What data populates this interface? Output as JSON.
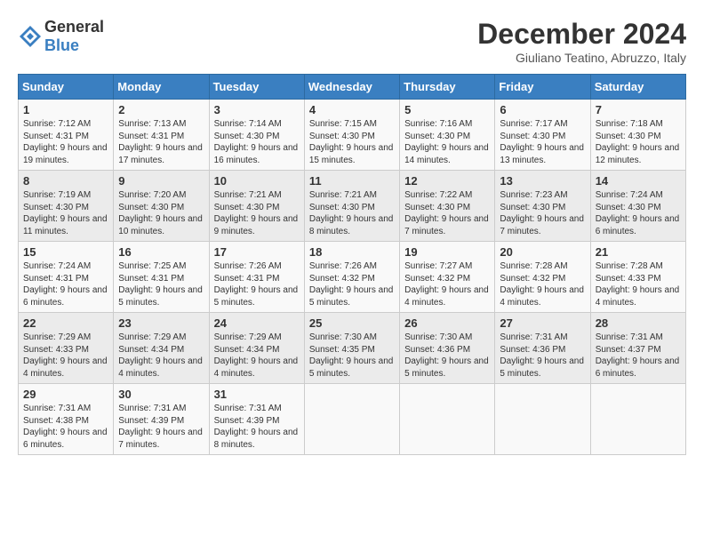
{
  "header": {
    "logo_general": "General",
    "logo_blue": "Blue",
    "month_title": "December 2024",
    "location": "Giuliano Teatino, Abruzzo, Italy"
  },
  "days_of_week": [
    "Sunday",
    "Monday",
    "Tuesday",
    "Wednesday",
    "Thursday",
    "Friday",
    "Saturday"
  ],
  "weeks": [
    [
      {
        "day": "1",
        "sunrise": "7:12 AM",
        "sunset": "4:31 PM",
        "daylight_hours": "9",
        "daylight_minutes": "19"
      },
      {
        "day": "2",
        "sunrise": "7:13 AM",
        "sunset": "4:31 PM",
        "daylight_hours": "9",
        "daylight_minutes": "17"
      },
      {
        "day": "3",
        "sunrise": "7:14 AM",
        "sunset": "4:30 PM",
        "daylight_hours": "9",
        "daylight_minutes": "16"
      },
      {
        "day": "4",
        "sunrise": "7:15 AM",
        "sunset": "4:30 PM",
        "daylight_hours": "9",
        "daylight_minutes": "15"
      },
      {
        "day": "5",
        "sunrise": "7:16 AM",
        "sunset": "4:30 PM",
        "daylight_hours": "9",
        "daylight_minutes": "14"
      },
      {
        "day": "6",
        "sunrise": "7:17 AM",
        "sunset": "4:30 PM",
        "daylight_hours": "9",
        "daylight_minutes": "13"
      },
      {
        "day": "7",
        "sunrise": "7:18 AM",
        "sunset": "4:30 PM",
        "daylight_hours": "9",
        "daylight_minutes": "12"
      }
    ],
    [
      {
        "day": "8",
        "sunrise": "7:19 AM",
        "sunset": "4:30 PM",
        "daylight_hours": "9",
        "daylight_minutes": "11"
      },
      {
        "day": "9",
        "sunrise": "7:20 AM",
        "sunset": "4:30 PM",
        "daylight_hours": "9",
        "daylight_minutes": "10"
      },
      {
        "day": "10",
        "sunrise": "7:21 AM",
        "sunset": "4:30 PM",
        "daylight_hours": "9",
        "daylight_minutes": "9"
      },
      {
        "day": "11",
        "sunrise": "7:21 AM",
        "sunset": "4:30 PM",
        "daylight_hours": "9",
        "daylight_minutes": "8"
      },
      {
        "day": "12",
        "sunrise": "7:22 AM",
        "sunset": "4:30 PM",
        "daylight_hours": "9",
        "daylight_minutes": "7"
      },
      {
        "day": "13",
        "sunrise": "7:23 AM",
        "sunset": "4:30 PM",
        "daylight_hours": "9",
        "daylight_minutes": "7"
      },
      {
        "day": "14",
        "sunrise": "7:24 AM",
        "sunset": "4:30 PM",
        "daylight_hours": "9",
        "daylight_minutes": "6"
      }
    ],
    [
      {
        "day": "15",
        "sunrise": "7:24 AM",
        "sunset": "4:31 PM",
        "daylight_hours": "9",
        "daylight_minutes": "6"
      },
      {
        "day": "16",
        "sunrise": "7:25 AM",
        "sunset": "4:31 PM",
        "daylight_hours": "9",
        "daylight_minutes": "5"
      },
      {
        "day": "17",
        "sunrise": "7:26 AM",
        "sunset": "4:31 PM",
        "daylight_hours": "9",
        "daylight_minutes": "5"
      },
      {
        "day": "18",
        "sunrise": "7:26 AM",
        "sunset": "4:32 PM",
        "daylight_hours": "9",
        "daylight_minutes": "5"
      },
      {
        "day": "19",
        "sunrise": "7:27 AM",
        "sunset": "4:32 PM",
        "daylight_hours": "9",
        "daylight_minutes": "4"
      },
      {
        "day": "20",
        "sunrise": "7:28 AM",
        "sunset": "4:32 PM",
        "daylight_hours": "9",
        "daylight_minutes": "4"
      },
      {
        "day": "21",
        "sunrise": "7:28 AM",
        "sunset": "4:33 PM",
        "daylight_hours": "9",
        "daylight_minutes": "4"
      }
    ],
    [
      {
        "day": "22",
        "sunrise": "7:29 AM",
        "sunset": "4:33 PM",
        "daylight_hours": "9",
        "daylight_minutes": "4"
      },
      {
        "day": "23",
        "sunrise": "7:29 AM",
        "sunset": "4:34 PM",
        "daylight_hours": "9",
        "daylight_minutes": "4"
      },
      {
        "day": "24",
        "sunrise": "7:29 AM",
        "sunset": "4:34 PM",
        "daylight_hours": "9",
        "daylight_minutes": "4"
      },
      {
        "day": "25",
        "sunrise": "7:30 AM",
        "sunset": "4:35 PM",
        "daylight_hours": "9",
        "daylight_minutes": "5"
      },
      {
        "day": "26",
        "sunrise": "7:30 AM",
        "sunset": "4:36 PM",
        "daylight_hours": "9",
        "daylight_minutes": "5"
      },
      {
        "day": "27",
        "sunrise": "7:31 AM",
        "sunset": "4:36 PM",
        "daylight_hours": "9",
        "daylight_minutes": "5"
      },
      {
        "day": "28",
        "sunrise": "7:31 AM",
        "sunset": "4:37 PM",
        "daylight_hours": "9",
        "daylight_minutes": "6"
      }
    ],
    [
      {
        "day": "29",
        "sunrise": "7:31 AM",
        "sunset": "4:38 PM",
        "daylight_hours": "9",
        "daylight_minutes": "6"
      },
      {
        "day": "30",
        "sunrise": "7:31 AM",
        "sunset": "4:39 PM",
        "daylight_hours": "9",
        "daylight_minutes": "7"
      },
      {
        "day": "31",
        "sunrise": "7:31 AM",
        "sunset": "4:39 PM",
        "daylight_hours": "9",
        "daylight_minutes": "8"
      },
      null,
      null,
      null,
      null
    ]
  ],
  "labels": {
    "sunrise": "Sunrise:",
    "sunset": "Sunset:",
    "daylight": "Daylight:",
    "daylight_hours_label": "hours",
    "daylight_and": "and",
    "daylight_minutes_label": "minutes."
  }
}
